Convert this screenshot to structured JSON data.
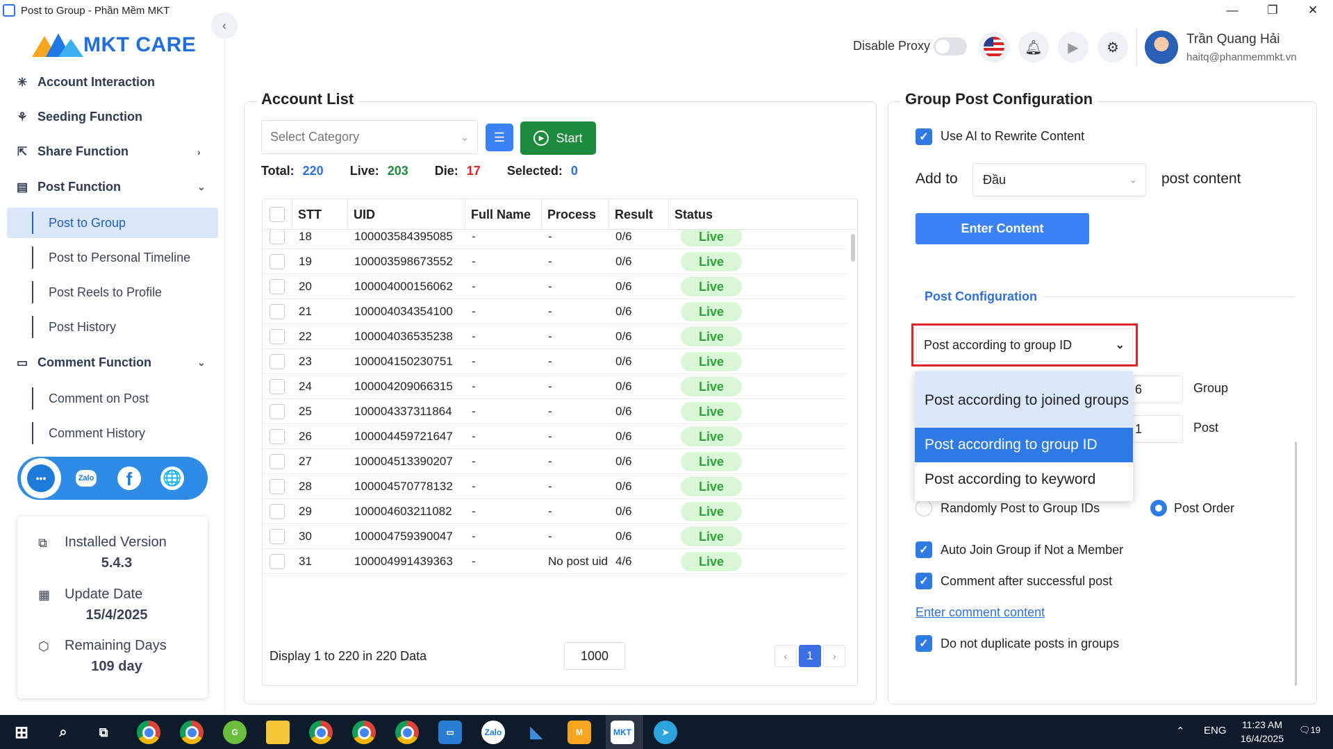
{
  "window": {
    "title": "Post to Group - Phần Mềm MKT",
    "controls": [
      "—",
      "❐",
      "✕"
    ]
  },
  "logo": {
    "text": "MKT CARE"
  },
  "sidebar": {
    "sections": [
      {
        "label": "Account Interaction",
        "icon": "sparkle-icon"
      },
      {
        "label": "Seeding Function",
        "icon": "seedling-icon"
      },
      {
        "label": "Share Function",
        "icon": "share-icon"
      },
      {
        "label": "Post Function",
        "icon": "post-icon"
      },
      {
        "label": "Comment Function",
        "icon": "comment-icon"
      }
    ],
    "post_items": [
      "Post to Group",
      "Post to Personal Timeline",
      "Post Reels to Profile",
      "Post History"
    ],
    "comment_items": [
      "Comment on Post",
      "Comment History"
    ],
    "social": {
      "zalo": "Zalo",
      "facebook": "f",
      "web": "🌐"
    },
    "info": {
      "installed_label": "Installed Version",
      "installed_value": "5.4.3",
      "update_label": "Update Date",
      "update_value": "15/4/2025",
      "remaining_label": "Remaining Days",
      "remaining_value": "109 day"
    }
  },
  "header": {
    "proxy_label": "Disable Proxy",
    "proxy_enabled": false,
    "user_name": "Trần Quang Hải",
    "user_email": "haitq@phanmemmkt.vn"
  },
  "account_list": {
    "title": "Account List",
    "category_placeholder": "Select Category",
    "start_label": "Start",
    "stats": {
      "total_label": "Total:",
      "total": "220",
      "live_label": "Live:",
      "live": "203",
      "die_label": "Die:",
      "die": "17",
      "selected_label": "Selected:",
      "selected": "0"
    },
    "columns": [
      "STT",
      "UID",
      "Full Name",
      "Process",
      "Result",
      "Status"
    ],
    "rows": [
      {
        "stt": "18",
        "uid": "100003584395085",
        "name": "-",
        "process": "-",
        "result": "0/6",
        "status": "Live"
      },
      {
        "stt": "19",
        "uid": "100003598673552",
        "name": "-",
        "process": "-",
        "result": "0/6",
        "status": "Live"
      },
      {
        "stt": "20",
        "uid": "100004000156062",
        "name": "-",
        "process": "-",
        "result": "0/6",
        "status": "Live"
      },
      {
        "stt": "21",
        "uid": "100004034354100",
        "name": "-",
        "process": "-",
        "result": "0/6",
        "status": "Live"
      },
      {
        "stt": "22",
        "uid": "100004036535238",
        "name": "-",
        "process": "-",
        "result": "0/6",
        "status": "Live"
      },
      {
        "stt": "23",
        "uid": "100004150230751",
        "name": "-",
        "process": "-",
        "result": "0/6",
        "status": "Live"
      },
      {
        "stt": "24",
        "uid": "100004209066315",
        "name": "-",
        "process": "-",
        "result": "0/6",
        "status": "Live"
      },
      {
        "stt": "25",
        "uid": "100004337311864",
        "name": "-",
        "process": "-",
        "result": "0/6",
        "status": "Live"
      },
      {
        "stt": "26",
        "uid": "100004459721647",
        "name": "-",
        "process": "-",
        "result": "0/6",
        "status": "Live"
      },
      {
        "stt": "27",
        "uid": "100004513390207",
        "name": "-",
        "process": "-",
        "result": "0/6",
        "status": "Live"
      },
      {
        "stt": "28",
        "uid": "100004570778132",
        "name": "-",
        "process": "-",
        "result": "0/6",
        "status": "Live"
      },
      {
        "stt": "29",
        "uid": "100004603211082",
        "name": "-",
        "process": "-",
        "result": "0/6",
        "status": "Live"
      },
      {
        "stt": "30",
        "uid": "100004759390047",
        "name": "-",
        "process": "-",
        "result": "0/6",
        "status": "Live"
      },
      {
        "stt": "31",
        "uid": "100004991439363",
        "name": "-",
        "process": "No post uid",
        "result": "4/6",
        "status": "Live"
      }
    ],
    "footer": {
      "display_text": "Display 1 to 220 in 220 Data",
      "page_size": "1000",
      "current_page": "1",
      "prev": "‹",
      "next": "›"
    }
  },
  "config": {
    "title": "Group Post Configuration",
    "use_ai_label": "Use AI to Rewrite Content",
    "use_ai_checked": true,
    "add_to_label": "Add to",
    "add_to_value": "Đầu",
    "post_content_label": "post content",
    "enter_content_label": "Enter Content",
    "post_config_title": "Post Configuration",
    "mode_selected": "Post according to group ID",
    "mode_options": [
      "Post according to joined groups",
      "Post according to group ID",
      "Post according to keyword"
    ],
    "group_value": "6",
    "group_unit": "Group",
    "post_value": "1",
    "post_unit": "Post",
    "random_label": "Randomly Post to Group IDs",
    "order_label": "Post Order",
    "auto_join_label": "Auto Join Group if Not a Member",
    "comment_after_label": "Comment after successful post",
    "enter_comment_label": "Enter comment content",
    "no_duplicate_label": "Do not duplicate posts in groups"
  },
  "taskbar": {
    "lang": "ENG",
    "time": "11:23 AM",
    "date": "16/4/2025",
    "notif_count": "19"
  },
  "colors": {
    "accent": "#2f7be6",
    "live_bg": "#d9f7d6",
    "live_text": "#2ea43a",
    "start_btn": "#1e8a3c",
    "highlight_border": "#e02424",
    "stat_blue": "#2f6fe0",
    "stat_green": "#1e8a3c",
    "stat_red": "#e02424"
  }
}
